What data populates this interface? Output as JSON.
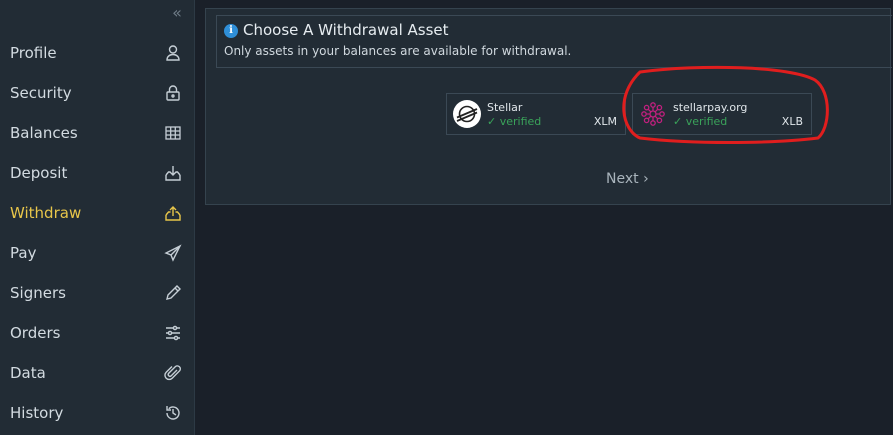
{
  "sidebar": {
    "collapse_icon": "double-chevron-left-icon",
    "items": [
      {
        "label": "Profile",
        "icon": "user-icon"
      },
      {
        "label": "Security",
        "icon": "lock-icon"
      },
      {
        "label": "Balances",
        "icon": "grid-icon"
      },
      {
        "label": "Deposit",
        "icon": "deposit-icon"
      },
      {
        "label": "Withdraw",
        "icon": "withdraw-icon",
        "active": true
      },
      {
        "label": "Pay",
        "icon": "paper-plane-icon"
      },
      {
        "label": "Signers",
        "icon": "pencil-icon"
      },
      {
        "label": "Orders",
        "icon": "sliders-icon"
      },
      {
        "label": "Data",
        "icon": "paperclip-icon"
      },
      {
        "label": "History",
        "icon": "history-icon"
      }
    ]
  },
  "main": {
    "title": "Choose A Withdrawal Asset",
    "subtitle": "Only assets in your balances are available for withdrawal.",
    "info_icon_glyph": "i",
    "assets": [
      {
        "name": "Stellar",
        "verified": "✓ verified",
        "code": "XLM",
        "icon": "stellar-logo-icon"
      },
      {
        "name": "stellarpay.org",
        "verified": "✓ verified",
        "code": "XLB",
        "icon": "stellarpay-logo-icon"
      }
    ],
    "next_label": "Next ›"
  },
  "colors": {
    "accent": "#e8c64a",
    "verified": "#3aa35a",
    "annotation": "#e01e1e"
  }
}
